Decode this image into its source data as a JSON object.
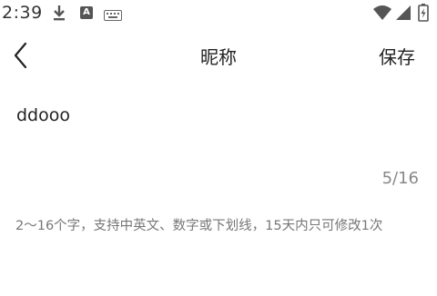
{
  "status_bar": {
    "time": "2:39",
    "a_badge": "A",
    "icons": [
      "download-icon",
      "a-badge-icon",
      "keyboard-icon",
      "wifi-icon",
      "signal-icon",
      "battery-icon"
    ]
  },
  "header": {
    "title": "昵称",
    "save_label": "保存",
    "back_icon": "chevron-left-icon"
  },
  "form": {
    "nickname_value": "ddooo",
    "counter": "5/16",
    "hint": "2～16个字，支持中英文、数字或下划线，15天内只可修改1次"
  },
  "colors": {
    "background": "#ffffff",
    "text_primary": "#222222",
    "text_secondary": "#888888"
  }
}
